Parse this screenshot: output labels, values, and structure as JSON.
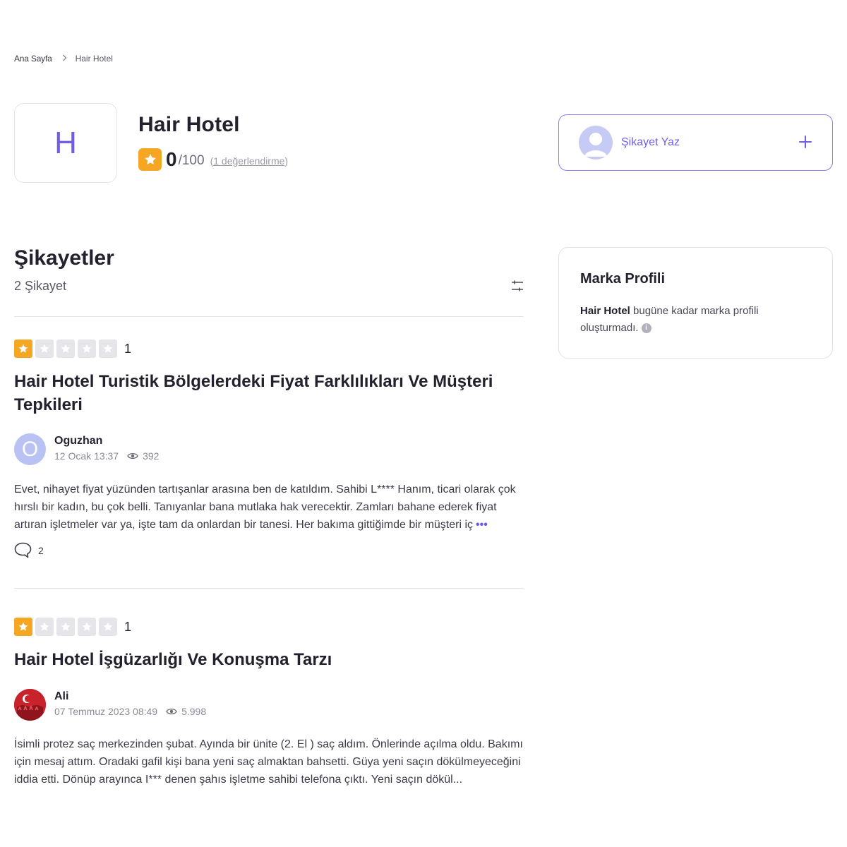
{
  "breadcrumb": {
    "home": "Ana Sayfa",
    "current": "Hair Hotel"
  },
  "brand": {
    "logo_letter": "H",
    "name": "Hair Hotel",
    "score": "0",
    "score_max": "/100",
    "review_count_open": "(",
    "review_count": "1 değerlendirme",
    "review_count_close": ")"
  },
  "write_complaint": {
    "label": "Şikayet Yaz"
  },
  "complaints_section": {
    "title": "Şikayetler",
    "count": "2 Şikayet"
  },
  "complaints": [
    {
      "rating": 1,
      "rating_label": "1",
      "title": "Hair Hotel Turistik Bölgelerdeki Fiyat Farklılıkları Ve Müşteri Tepkileri",
      "author": "Oguzhan",
      "avatar_letter": "O",
      "date": "12 Ocak 13:37",
      "views": "392",
      "excerpt": "Evet, nihayet fiyat yüzünden tartışanlar arasına ben de katıldım. Sahibi L**** Hanım, ticari olarak çok hırslı bir kadın, bu çok belli. Tanıyanlar bana mutlaka hak verecektir. Zamları bahane ederek fiyat artıran işletmeler var ya, işte tam da onlardan bir tanesi. Her bakıma gittiğimde bir müşteri iç",
      "more": "•••",
      "comment_count": "2"
    },
    {
      "rating": 1,
      "rating_label": "1",
      "title": "Hair Hotel İşgüzarlığı Ve Konuşma Tarzı",
      "author": "Ali",
      "date": "07 Temmuz 2023 08:49",
      "views": "5.998",
      "excerpt": "İsimli protez saç merkezinden şubat. Ayında bir ünite (2. El ) saç aldım. Önlerinde açılma oldu. Bakımı için mesaj attım. Oradaki gafil kişi bana yeni saç almaktan bahsetti. Güya yeni saçın dökülmeyeceğini iddia etti. Dönüp arayınca I*** denen şahıs işletme sahibi telefona çıktı. Yeni saçın dökül..."
    }
  ],
  "brand_profile": {
    "title": "Marka Profili",
    "brand_name": "Hair Hotel",
    "text": " bugüne kadar marka profili oluşturmadı."
  },
  "colors": {
    "accent": "#6f5de8",
    "star": "#f5a623",
    "star_off": "#e5e5ea"
  }
}
